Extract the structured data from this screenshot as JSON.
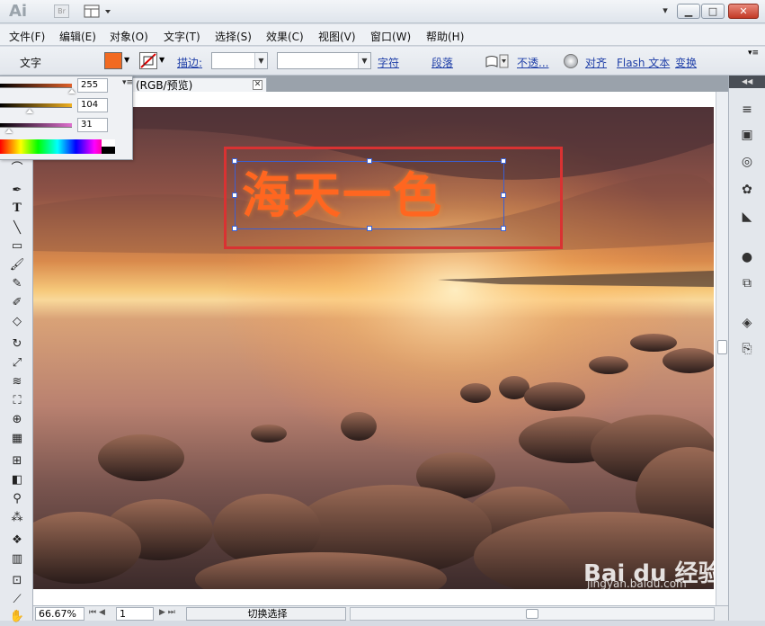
{
  "titlebar": {
    "logo": "Ai",
    "bridge_badge": "Br",
    "buttons": [
      "▾",
      "▁",
      "□",
      "✕"
    ]
  },
  "menubar": {
    "items": [
      "文件(F)",
      "编辑(E)",
      "对象(O)",
      "文字(T)",
      "选择(S)",
      "效果(C)",
      "视图(V)",
      "窗口(W)",
      "帮助(H)"
    ]
  },
  "controlbar": {
    "tool_name": "文字",
    "fill_color": "#f26a21",
    "stroke_label": "描边:",
    "links": [
      "字符",
      "段落",
      "不透...",
      "对齐",
      "Flash 文本",
      "变换"
    ]
  },
  "color_panel": {
    "values": [
      "255",
      "104",
      "31"
    ],
    "levels": [
      1.0,
      0.41,
      0.12
    ],
    "track_colors": [
      "#e0612a",
      "#f0b020",
      "#e070d0"
    ]
  },
  "document": {
    "tab_label": "(RGB/预览)",
    "close_glyph": "✕",
    "headline": "海天一色"
  },
  "statusbar": {
    "zoom": "66.67%",
    "artboard": "1",
    "mode": "切换选择"
  },
  "watermark": {
    "brand": "Bai du 经验",
    "url": "jingyan.baidu.com"
  },
  "tools": [
    "pen-icon",
    "type-icon",
    "line-icon",
    "rectangle-icon",
    "brush-icon",
    "pencil-icon",
    "blob-brush-icon",
    "eraser-icon",
    "rotate-icon",
    "scale-icon",
    "warp-icon",
    "free-transform-icon",
    "shape-builder-icon",
    "graph-icon",
    "mesh-icon",
    "gradient-icon",
    "eyedropper-icon",
    "blend-icon",
    "symbol-icon",
    "column-graph-icon",
    "artboard-icon",
    "slice-icon",
    "hand-icon"
  ],
  "dock": [
    "color-icon",
    "swatches-icon",
    "brushes-icon",
    "symbols-icon",
    "graphic-styles-icon",
    "appearance-icon",
    "layers-icon",
    "artboards-icon"
  ],
  "colors": {
    "accent_orange": "#ff6620",
    "selection_blue": "#3b5fd0",
    "frame_red": "#d93232"
  }
}
